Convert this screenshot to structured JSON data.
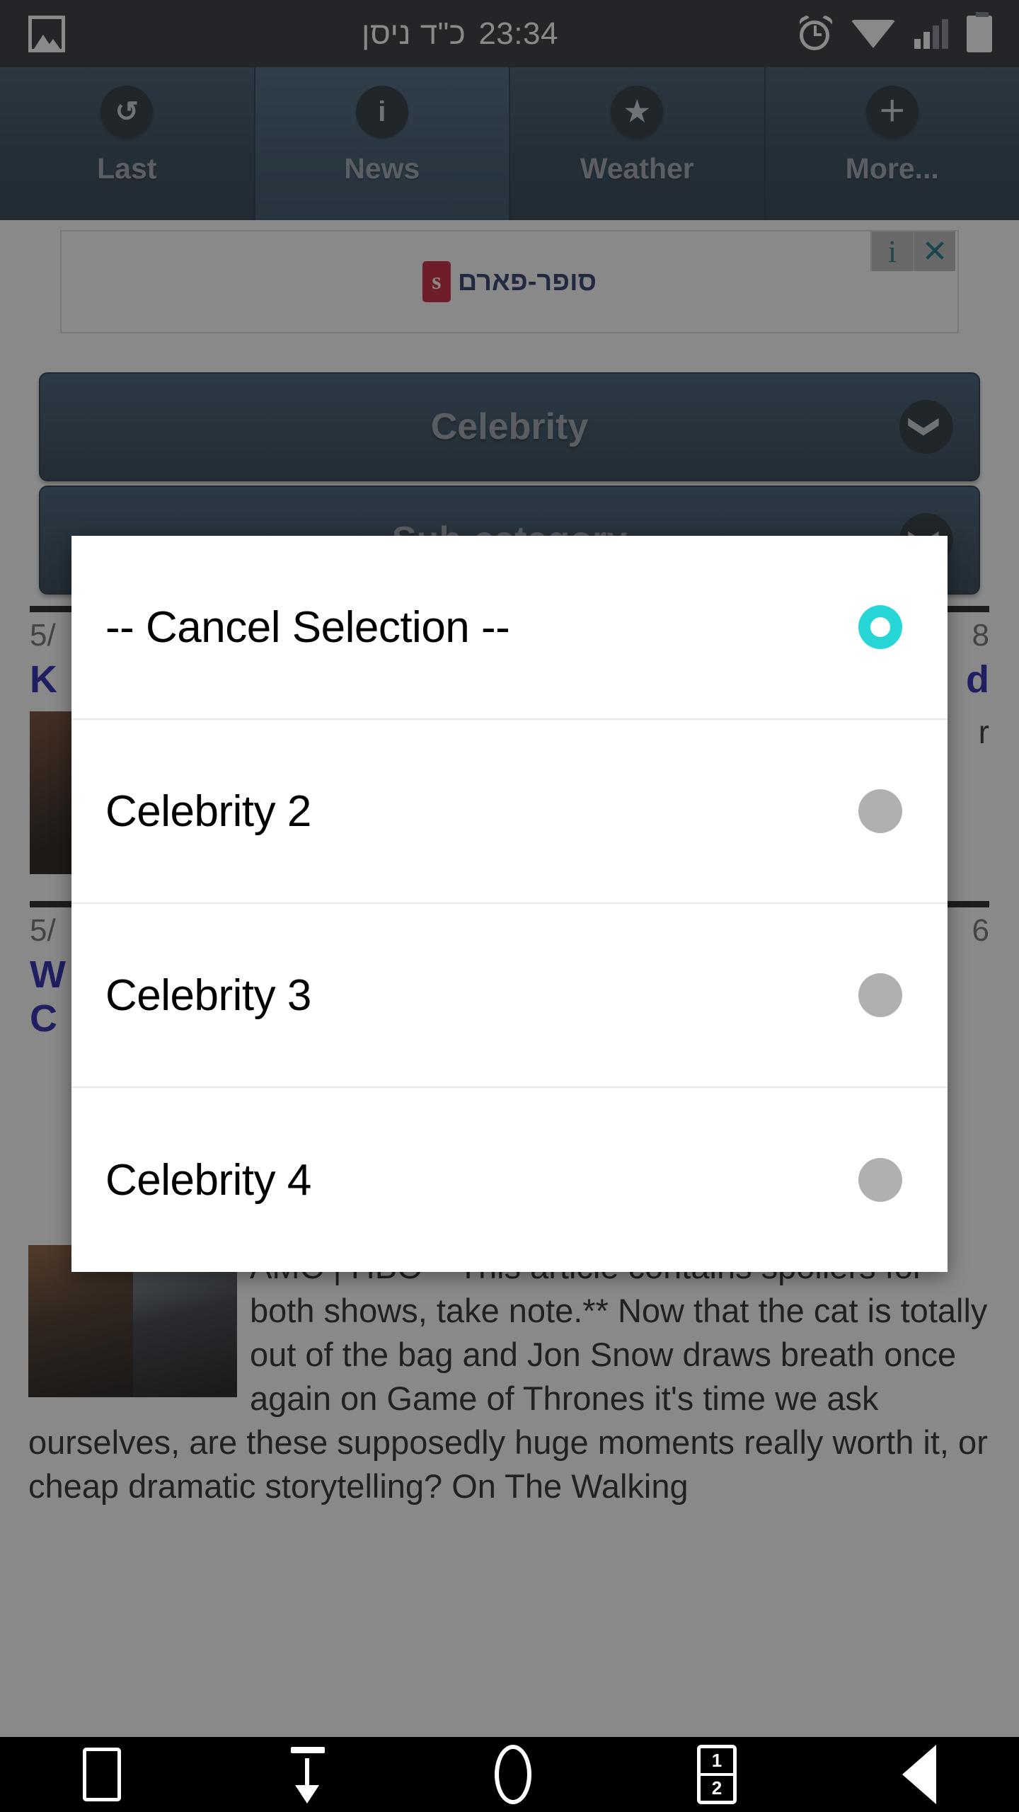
{
  "status_bar": {
    "time": "23:34",
    "hebrew_date": "כ\"ד ניסן",
    "photo_icon": "photo-icon",
    "alarm_icon": "alarm-icon",
    "wifi_icon": "wifi-icon",
    "signal_icon": "signal-icon",
    "battery_icon": "battery-icon",
    "background_color": "#1d222c"
  },
  "tabs": [
    {
      "label": "Last",
      "icon": "undo-arrow-icon",
      "glyph": "↺",
      "selected": false
    },
    {
      "label": "News",
      "icon": "info-icon",
      "glyph": "i",
      "selected": true
    },
    {
      "label": "Weather",
      "icon": "star-icon",
      "glyph": "★",
      "selected": false
    },
    {
      "label": "More...",
      "icon": "plus-icon",
      "glyph": "＋",
      "selected": false
    }
  ],
  "ad": {
    "brand_text": "סופר-פארם",
    "brand_mark": "s",
    "info_label": "i",
    "close_label": "✕",
    "accent_color": "#0c6e78"
  },
  "selectors": [
    {
      "title": "Celebrity",
      "chevron": "❯"
    },
    {
      "title": "Sub-category",
      "chevron": "❯"
    }
  ],
  "news_items": [
    {
      "date_left": "5/",
      "date_right": "8",
      "headline": "K",
      "headline_tail": "d",
      "snippet": "r"
    },
    {
      "date_left": "5/",
      "date_right": "6",
      "headline": "W",
      "headline_tail": "",
      "snippet": ""
    }
  ],
  "news_row_1": {
    "date_left": "5/",
    "date_right": "8",
    "head_left": "K",
    "head_right": "d",
    "snippet": "r"
  },
  "news_row_2": {
    "date_left": "5/",
    "date_right": "6",
    "head_left": "W",
    "head_left2": "C",
    "head_right": ""
  },
  "article": {
    "text": "AMC | HBO **This article contains spoilers for both shows, take note.** Now that the cat is totally out of the bag and Jon Snow draws breath once again on Game of Thrones it's time we ask ourselves, are these supposedly huge moments really worth it, or cheap dramatic storytelling? On The Walking"
  },
  "modal": {
    "options": [
      {
        "label": "-- Cancel Selection --",
        "selected": true
      },
      {
        "label": "Celebrity 2",
        "selected": false
      },
      {
        "label": "Celebrity 3",
        "selected": false
      },
      {
        "label": "Celebrity 4",
        "selected": false
      }
    ],
    "selected_color": "#27d6d6",
    "unselected_color": "#b0b0b0"
  },
  "nav_bar": {
    "recents_icon": "square-recents-icon",
    "download_icon": "download-arrow-icon",
    "home_icon": "circle-home-icon",
    "split_icon": "split-screen-icon",
    "split_top": "1",
    "split_bottom": "2",
    "back_icon": "back-triangle-icon"
  }
}
